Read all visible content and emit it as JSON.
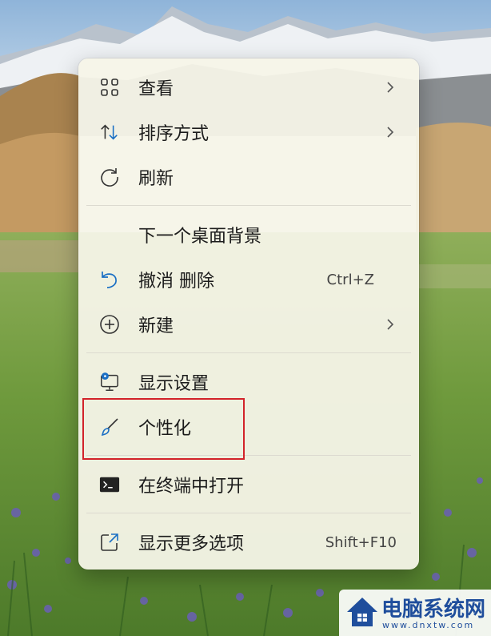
{
  "menu": {
    "items": [
      {
        "label": "查看",
        "icon": "grid-view-icon",
        "submenu": true
      },
      {
        "label": "排序方式",
        "icon": "sort-icon",
        "submenu": true
      },
      {
        "label": "刷新",
        "icon": "refresh-icon"
      },
      {
        "label": "下一个桌面背景",
        "icon": ""
      },
      {
        "label": "撤消 删除",
        "icon": "undo-icon",
        "shortcut": "Ctrl+Z"
      },
      {
        "label": "新建",
        "icon": "add-circle-icon",
        "submenu": true
      },
      {
        "label": "显示设置",
        "icon": "display-settings-icon"
      },
      {
        "label": "个性化",
        "icon": "brush-icon",
        "highlighted": true
      },
      {
        "label": "在终端中打开",
        "icon": "terminal-icon"
      },
      {
        "label": "显示更多选项",
        "icon": "open-external-icon",
        "shortcut": "Shift+F10"
      }
    ]
  },
  "highlight_color": "#d2232a",
  "accent_color": "#1a6fc4",
  "watermark": {
    "text": "电脑系统网",
    "url": "www.dnxtw.com"
  }
}
